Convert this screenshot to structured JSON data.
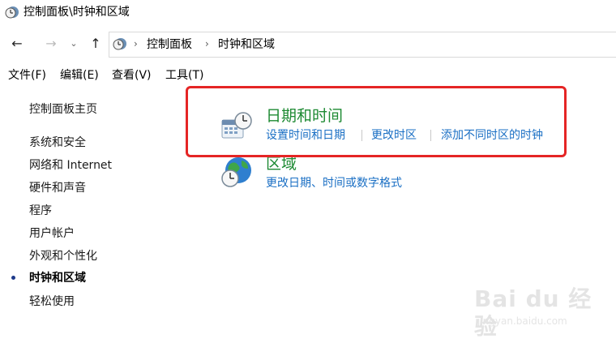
{
  "window": {
    "title": "控制面板\\时钟和区域",
    "icon": "clock-globe-icon"
  },
  "nav": {
    "back_glyph": "←",
    "forward_glyph": "→",
    "recent_glyph": "⌄",
    "up_glyph": "↑",
    "breadcrumb": [
      "控制面板",
      "时钟和区域"
    ]
  },
  "menu": [
    "文件(F)",
    "编辑(E)",
    "查看(V)",
    "工具(T)"
  ],
  "sidebar": {
    "home": "控制面板主页",
    "items": [
      "系统和安全",
      "网络和 Internet",
      "硬件和声音",
      "程序",
      "用户帐户",
      "外观和个性化",
      "时钟和区域",
      "轻松使用"
    ],
    "current": "时钟和区域"
  },
  "categories": [
    {
      "title": "日期和时间",
      "icon": "date-time-icon",
      "links": [
        "设置时间和日期",
        "更改时区",
        "添加不同时区的时钟"
      ]
    },
    {
      "title": "区域",
      "icon": "region-globe-icon",
      "links": [
        "更改日期、时间或数字格式"
      ]
    }
  ],
  "watermark": {
    "text": "Bai du 经验",
    "sub": "jingyan.baidu.com"
  },
  "colors": {
    "category_title": "#1e8a33",
    "task_link": "#1a6fc4",
    "highlight": "#e52525"
  }
}
